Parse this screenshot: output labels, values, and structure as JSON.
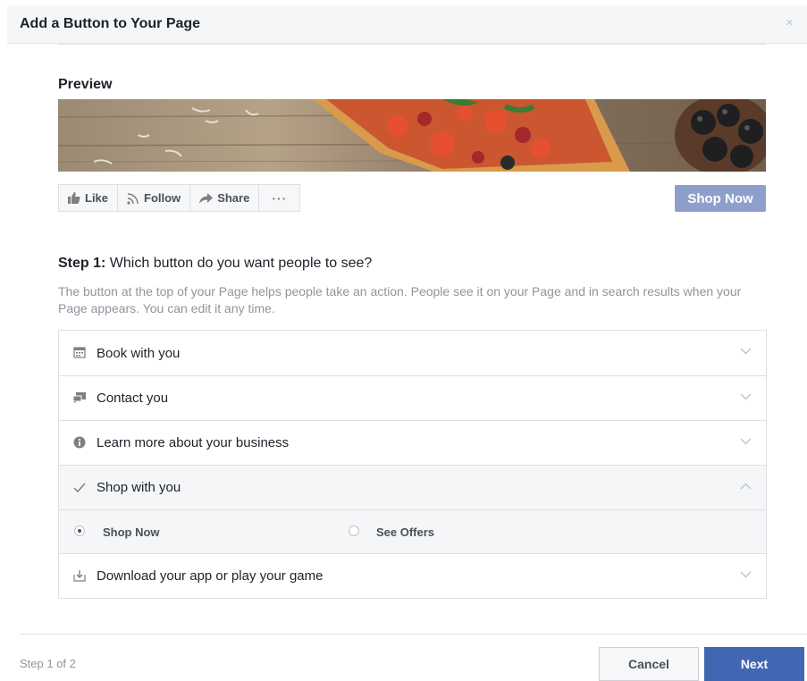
{
  "dialog": {
    "title": "Add a Button to Your Page",
    "close_glyph": "×"
  },
  "preview": {
    "title": "Preview",
    "actions": [
      {
        "label": "Like",
        "icon": "thumbs-up-icon"
      },
      {
        "label": "Follow",
        "icon": "rss-icon"
      },
      {
        "label": "Share",
        "icon": "share-arrow-icon"
      },
      {
        "label": "···",
        "icon": "more-icon"
      }
    ],
    "cta_label": "Shop Now"
  },
  "step": {
    "label": "Step 1:",
    "question": " Which button do you want people to see?",
    "description": "The button at the top of your Page helps people take an action. People see it on your Page and in search results when your Page appears. You can edit it any time."
  },
  "options": [
    {
      "label": "Book with you",
      "icon": "calendar-icon",
      "expanded": false
    },
    {
      "label": "Contact you",
      "icon": "chat-bubbles-icon",
      "expanded": false
    },
    {
      "label": "Learn more about your business",
      "icon": "info-icon",
      "expanded": false
    },
    {
      "label": "Shop with you",
      "icon": "checkmark-icon",
      "expanded": true
    },
    {
      "label": "Download your app or play your game",
      "icon": "download-icon",
      "expanded": false
    }
  ],
  "shop_choices": [
    {
      "label": "Shop Now",
      "selected": true
    },
    {
      "label": "See Offers",
      "selected": false
    }
  ],
  "footer": {
    "step_count": "Step 1 of 2",
    "cancel_label": "Cancel",
    "next_label": "Next"
  },
  "colors": {
    "primary": "#4267b2",
    "cta_preview": "#8e9fcc",
    "muted_text": "#90949c"
  }
}
